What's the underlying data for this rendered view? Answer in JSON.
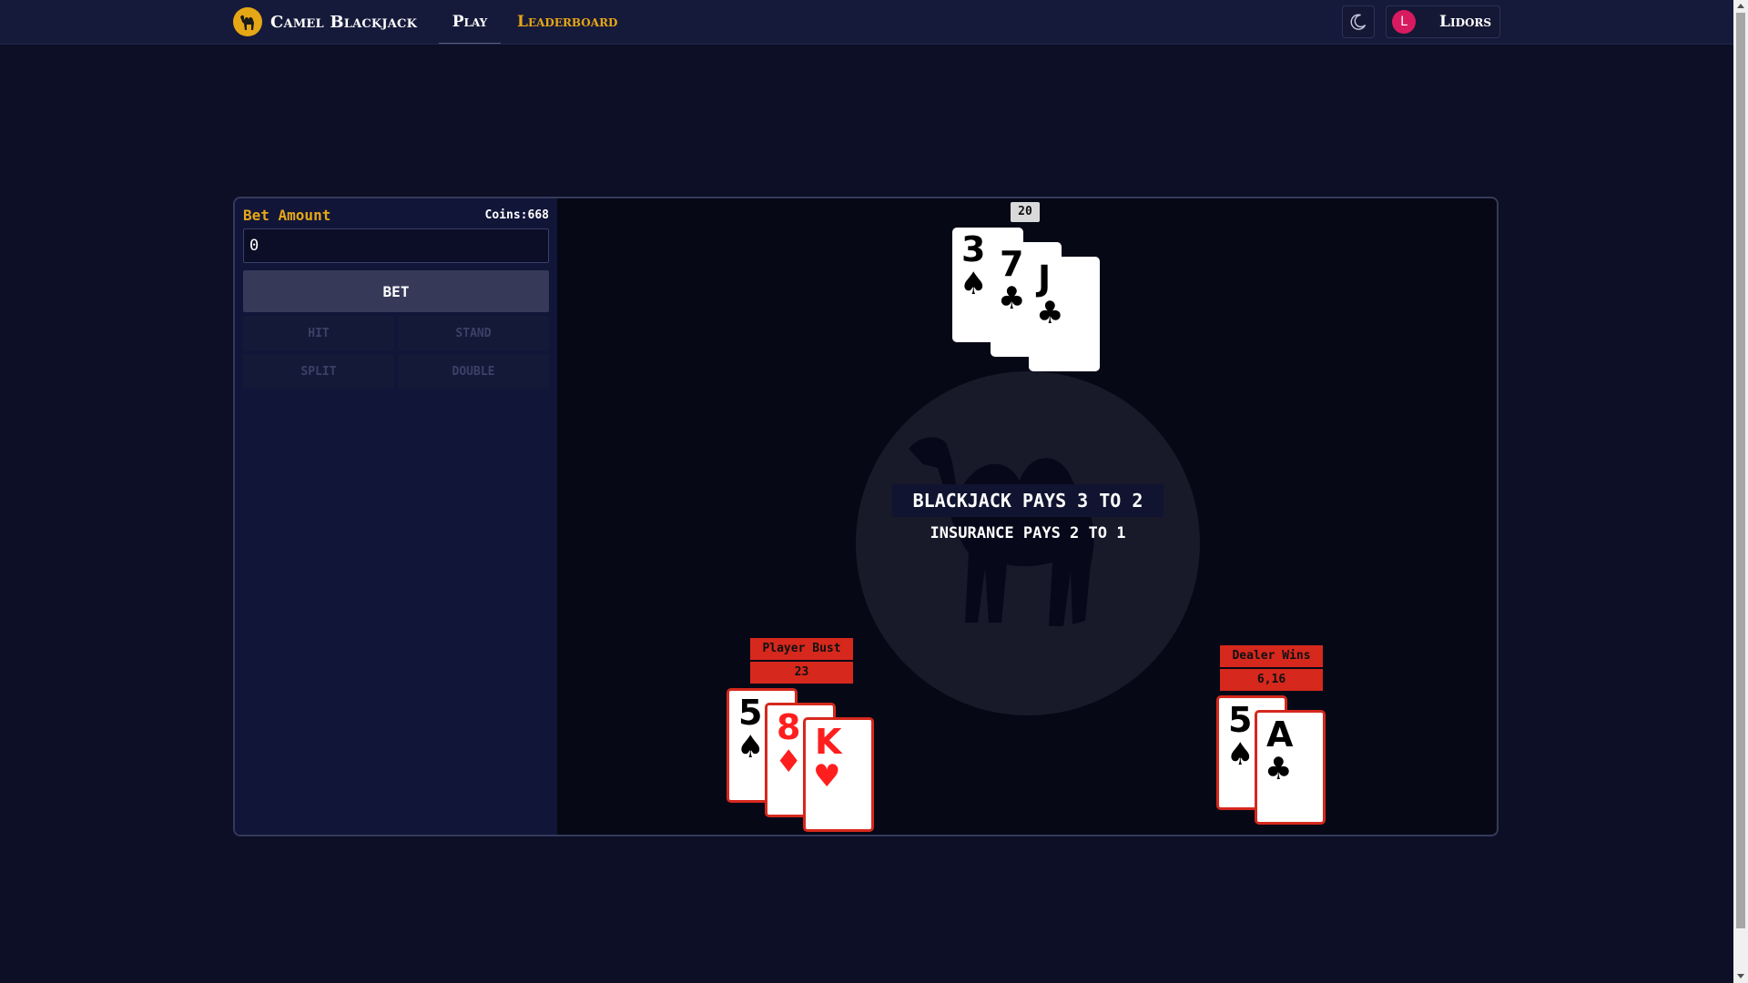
{
  "navbar": {
    "brand": "Camel Blackjack",
    "links": {
      "play": "Play",
      "leaderboard": "Leaderboard"
    },
    "user": {
      "initial": "L",
      "name": "Lidors"
    }
  },
  "sidebar": {
    "bet_label": "Bet Amount",
    "coins": "Coins:668",
    "bet_value": "0",
    "bet_button": "BET",
    "actions": {
      "hit": "HIT",
      "stand": "STAND",
      "split": "SPLIT",
      "double": "DOUBLE"
    }
  },
  "table": {
    "rules_main": "BLACKJACK PAYS 3 TO 2",
    "rules_sub": "INSURANCE PAYS 2 TO 1",
    "top_hand": {
      "score": "20",
      "cards": [
        {
          "rank": "3",
          "suit": "♠"
        },
        {
          "rank": "7",
          "suit": "♣"
        },
        {
          "rank": "J",
          "suit": "♣"
        }
      ]
    },
    "player_hand": {
      "status": "Player Bust",
      "score": "23",
      "cards": [
        {
          "rank": "5",
          "suit": "♠"
        },
        {
          "rank": "8",
          "suit": "♦"
        },
        {
          "rank": "K",
          "suit": "♥"
        }
      ]
    },
    "dealer_hand": {
      "status": "Dealer Wins",
      "score": "6,16",
      "cards": [
        {
          "rank": "5",
          "suit": "♠"
        },
        {
          "rank": "A",
          "suit": "♣"
        }
      ]
    }
  },
  "colors": {
    "accent": "#e6a716",
    "background": "#0c0f25",
    "navbar": "#161a3a",
    "status_red": "#d6281d",
    "avatar": "#d81b60"
  },
  "icons": {
    "brand": "camel-icon",
    "theme": "moon-icon"
  }
}
